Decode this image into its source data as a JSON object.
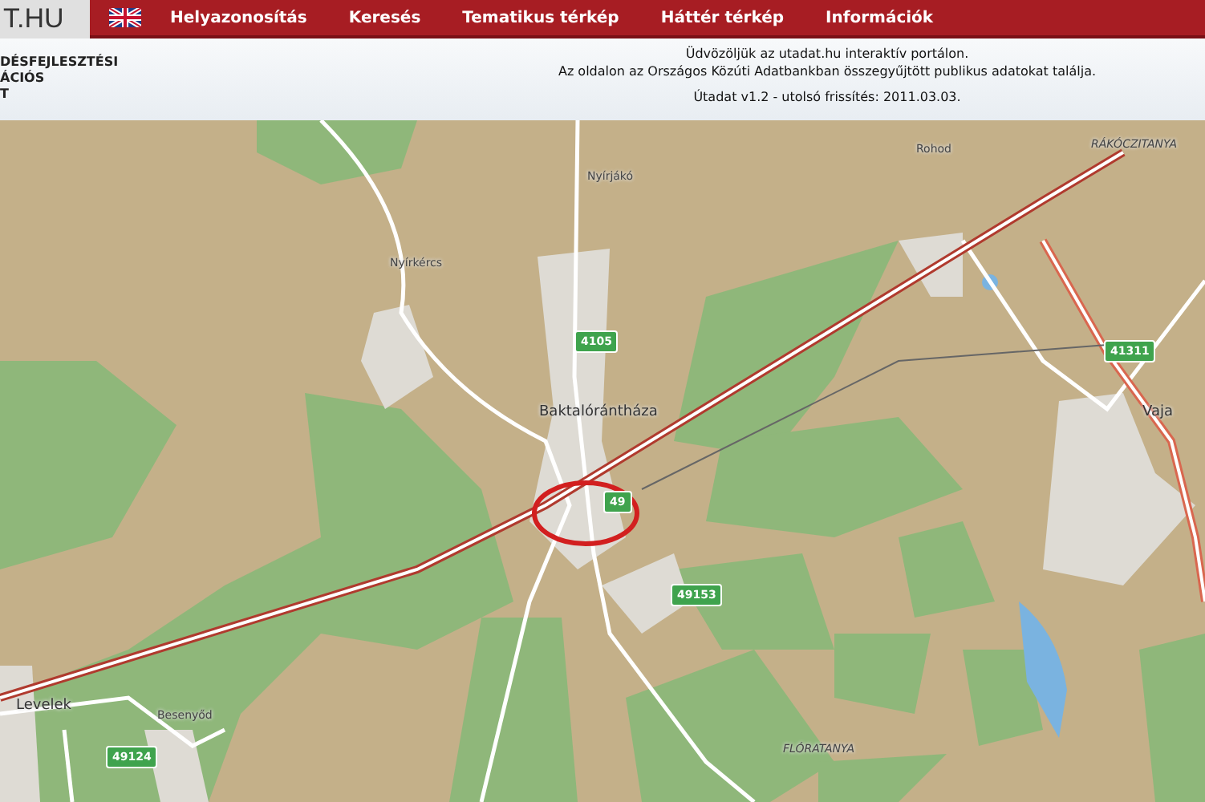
{
  "header": {
    "logo_text": "T.HU",
    "nav": [
      {
        "label": "Helyazonosítás"
      },
      {
        "label": "Keresés"
      },
      {
        "label": "Tematikus térkép"
      },
      {
        "label": "Háttér térkép"
      },
      {
        "label": "Információk"
      }
    ],
    "org_lines": [
      "DÉSFEJLESZTÉSI",
      "ÁCIÓS",
      "T"
    ],
    "welcome": [
      "Üdvözöljük az utadat.hu interaktív portálon.",
      "Az oldalon az Országos Közúti Adatbankban összegyűjtött publikus adatokat találja."
    ],
    "version": "Útadat v1.2 - utolsó frissítés: 2011.03.03."
  },
  "map": {
    "places": [
      {
        "name": "Nyírjákó",
        "kind": "village"
      },
      {
        "name": "Nyírkércs",
        "kind": "village"
      },
      {
        "name": "Baktalórántháza",
        "kind": "town"
      },
      {
        "name": "Rohod",
        "kind": "village"
      },
      {
        "name": "RÁKÓCZITANYA",
        "kind": "farm"
      },
      {
        "name": "Vaja",
        "kind": "town"
      },
      {
        "name": "Levelek",
        "kind": "town"
      },
      {
        "name": "Besenyőd",
        "kind": "village"
      },
      {
        "name": "FLÓRATANYA",
        "kind": "farm"
      }
    ],
    "road_badges": [
      "4105",
      "41311",
      "49",
      "49153",
      "49124"
    ]
  }
}
